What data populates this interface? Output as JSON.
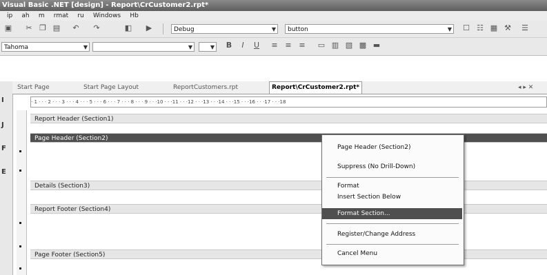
{
  "window": {
    "title": "Visual Basic .NET [design] - Report\\CrCustomer2.rpt*"
  },
  "menubar": {
    "items": [
      "ip",
      "ah",
      "m",
      "rmat",
      "ru",
      "Windows",
      "Hb"
    ]
  },
  "toolbar1": {
    "config_combo": "Debug",
    "project_combo": "button"
  },
  "toolbar2": {
    "font_combo": "Tahoma"
  },
  "tabs": [
    "Start Page",
    "Start Page Layout",
    "ReportCustomers.rpt",
    "Report\\CrCustomer2.rpt*"
  ],
  "close_tab_glyph": "◂ ▸ ✕",
  "ruler": {
    "text": "· 1 · · · 2 · · · 3 · · · 4 · · · 5 · · · 6 · · · 7 · · · 8 · · · 9 · · ·10 · · ·11 · · ·12 · · ·13 · · ·14 · · ·15 · · ·16 · · ·17 · · ·18"
  },
  "sections": [
    {
      "label": "Report Header (Section1)",
      "selected": false
    },
    {
      "label": "Page Header (Section2)",
      "selected": true
    },
    {
      "label": "Details (Section3)",
      "selected": false
    },
    {
      "label": "Report Footer (Section4)",
      "selected": false
    },
    {
      "label": "Page Footer (Section5)",
      "selected": false
    }
  ],
  "gutter_marks": [
    "I",
    "J",
    "F",
    "E"
  ],
  "context_menu": {
    "items": [
      "Page Header (Section2)",
      "Suppress (No Drill-Down)",
      "Format",
      "Insert Section Below",
      "Format Section...",
      "Register/Change Address",
      "Cancel Menu"
    ],
    "highlighted_index": 4
  },
  "colors": {
    "selected_section": "#505050",
    "menu_highlight": "#4f4f4f"
  }
}
